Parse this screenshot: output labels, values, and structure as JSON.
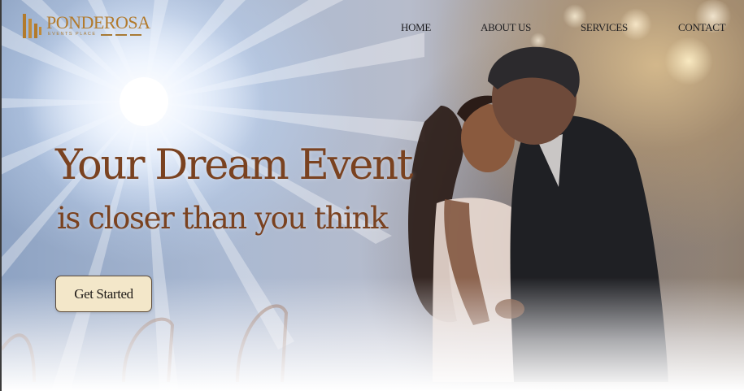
{
  "brand": {
    "name": "PONDEROSA",
    "tagline": "EVENTS PLACE",
    "color": "#b27a2c"
  },
  "nav": {
    "items": [
      {
        "label": "HOME"
      },
      {
        "label": "ABOUT US"
      },
      {
        "label": "SERVICES"
      },
      {
        "label": "CONTACT"
      }
    ]
  },
  "hero": {
    "headline": "Your Dream Event",
    "subheadline": "is closer than you think",
    "cta_label": "Get Started",
    "headline_color": "#7a4220",
    "cta_bg": "#f3e7c9",
    "image": "wedding-couple-photo"
  }
}
